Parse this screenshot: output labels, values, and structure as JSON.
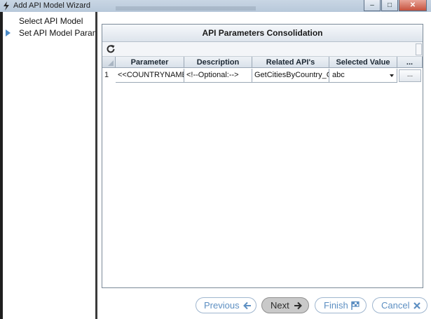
{
  "window": {
    "title": "Add API Model Wizard",
    "controls": {
      "minimize": "‒",
      "maximize": "□",
      "close": "✕"
    }
  },
  "steps": [
    {
      "label": "Select API Model",
      "active": false
    },
    {
      "label": "Set API Model Parameters",
      "active": true
    }
  ],
  "panel": {
    "title": "API Parameters Consolidation",
    "toolbar": {
      "refresh_icon": "refresh-icon"
    }
  },
  "grid": {
    "columns": [
      "Parameter",
      "Description",
      "Related API's",
      "Selected Value",
      "..."
    ],
    "rows": [
      {
        "row_number": "1",
        "parameter": "<<COUNTRYNAME>>",
        "description": "<!--Optional:-->",
        "related_apis": "GetCitiesByCountry_GlobalWeather",
        "selected_value": "abc",
        "more": "..."
      }
    ]
  },
  "footer": {
    "previous": "Previous",
    "next": "Next",
    "finish": "Finish",
    "cancel": "Cancel"
  },
  "colors": {
    "accent": "#5d8fc2",
    "step_arrow": "#4b8bc7",
    "next_button_bg": "#c9c9c9"
  }
}
